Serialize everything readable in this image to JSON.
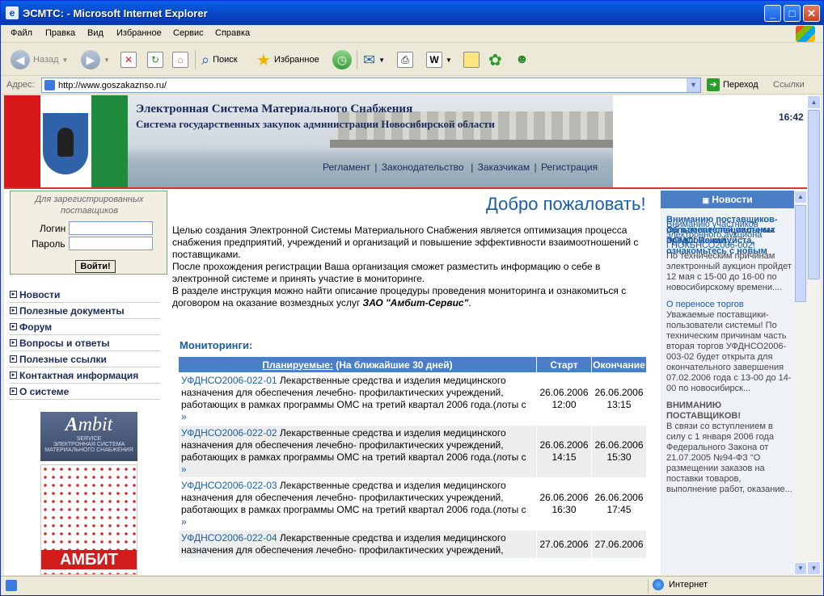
{
  "window": {
    "title": "ЭСМТС:  - Microsoft Internet Explorer"
  },
  "menu": [
    "Файл",
    "Правка",
    "Вид",
    "Избранное",
    "Сервис",
    "Справка"
  ],
  "toolbar": {
    "back": "Назад",
    "search": "Поиск",
    "favorites": "Избранное"
  },
  "address": {
    "label": "Адрес:",
    "url": "http://www.goszakaznso.ru/",
    "go": "Переход",
    "links": "Ссылки"
  },
  "banner": {
    "title": "Электронная Система Материального Снабжения",
    "subtitle": "Система государственных закупок администрации Новосибирской области",
    "nav": [
      "Регламент",
      "Законодательство",
      "Заказчикам",
      "Регистрация"
    ],
    "time": "16:42"
  },
  "login": {
    "header": "Для зарегистрированных поставщиков",
    "login_label": "Логин",
    "password_label": "Пароль",
    "button": "Войти!"
  },
  "sidebar": [
    "Новости",
    "Полезные документы",
    "Форум",
    "Вопросы и ответы",
    "Полезные ссылки",
    "Контактная информация",
    "О системе"
  ],
  "ads": {
    "ambit_logo": "mbit",
    "ambit_service": "SERVICE",
    "ambit_caption": "ЭЛЕКТРОННАЯ СИСТЕМА МАТЕРИАЛЬНОГО СНАБЖЕНИЯ",
    "ambit_red": "АМБИТ"
  },
  "main": {
    "welcome": "Добро пожаловать!",
    "intro1": "Целью создания Электронной Системы Материального Снабжения является оптимизация процесса снабжения предприятий, учреждений и организаций и повышение эффективности взаимоотношений с поставщиками.",
    "intro2": "После прохождения регистрации Ваша организация сможет разместить информацию о себе в электронной системе и принять участие в мониторинге.",
    "intro3": "В разделе инструкция можно найти описание процедуры проведения мониторинга и ознакомиться с договором на оказание возмездных услуг",
    "intro3_company": "ЗАО \"Амбит-Сервис\"",
    "monitoring_title": "Мониторинги:",
    "table": {
      "head_link": "Планируемые:",
      "head_rest": " (На ближайшие 30 дней)",
      "start": "Старт",
      "end": "Окончание",
      "rows": [
        {
          "id": "УФДНСО2006-022-01",
          "text": "Лекарственные средства и изделия медицинского назначения для обеспечения лечебно- профилактических учреждений, работающих в рамках программы ОМС на третий квартал 2006 года.(лоты с",
          "start": "26.06.2006 12:00",
          "end": "26.06.2006 13:15"
        },
        {
          "id": "УФДНСО2006-022-02",
          "text": "Лекарственные средства и изделия медицинского назначения для обеспечения лечебно- профилактических учреждений, работающих в рамках программы ОМС на третий квартал 2006 года.(лоты с",
          "start": "26.06.2006 14:15",
          "end": "26.06.2006 15:30"
        },
        {
          "id": "УФДНСО2006-022-03",
          "text": "Лекарственные средства и изделия медицинского назначения для обеспечения лечебно- профилактических учреждений, работающих в рамках программы ОМС на третий квартал 2006 года.(лоты с",
          "start": "26.06.2006 16:30",
          "end": "26.06.2006 17:45"
        },
        {
          "id": "УФДНСО2006-022-04",
          "text": "Лекарственные средства и изделия медицинского назначения для обеспечения лечебно- профилактических учреждений,",
          "start": "27.06.2006",
          "end": "27.06.2006"
        }
      ]
    }
  },
  "news": {
    "header": "Новости",
    "items": [
      {
        "title": "Вниманию участников электронного аукциона ГНОКБНСО2006-002!",
        "body": "По техническим причинам электронный аукцион пройдет 12 мая с 15-00 до 16-00 по новосибирскому времени...."
      },
      {
        "title": "О переносе торгов",
        "body": "Уважаемые поставщики-пользователи системы! По техническим причинам часть вторая торгов УФДНСО2006-003-02 будет открыта для окончательного завершения 07.02.2006 года с 13-00 до 14-00 по новосибирск..."
      },
      {
        "title": "Об отмене специальных предложений",
        "bold": "ВНИМАНИЮ ПОСТАВЩИКОВ!",
        "body": "В связи со вступлением в силу с 1 января 2006 года Федерального Закона от 21.07.2005 №94-ФЗ \"О размещении заказов на поставки товаров, выполнение работ, оказание..."
      },
      {
        "title": "Вниманию поставщиков-пользователей системы ЭСМС! Пожалуйста, ознакомьтесь с новым"
      }
    ]
  },
  "status": {
    "zone": "Интернет"
  }
}
